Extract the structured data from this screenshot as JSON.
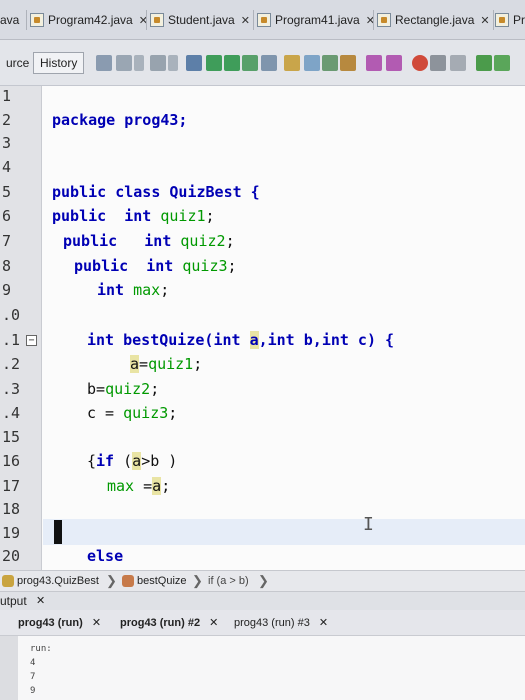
{
  "tabs": [
    {
      "label": "ava"
    },
    {
      "label": "Program42.java"
    },
    {
      "label": "Student.java"
    },
    {
      "label": "Program41.java"
    },
    {
      "label": "Rectangle.java"
    },
    {
      "label": "Pro"
    }
  ],
  "close_glyph": "✕",
  "toolbar": {
    "source_label": "urce",
    "history_label": "History"
  },
  "line_numbers": [
    "1",
    "2",
    "3",
    "4",
    "5",
    "6",
    "7",
    "8",
    "9",
    ".0",
    ".1",
    ".2",
    ".3",
    ".4",
    "15",
    "16",
    "17",
    "18",
    "19",
    "20"
  ],
  "code": {
    "l2_kw": "package",
    "l2_rest": " prog43;",
    "l5_kw1": "public",
    "l5_kw2": "class",
    "l5_rest": " QuizBest {",
    "l6_kw1": "public",
    "l6_kw2": "int",
    "l6_field": "quiz1",
    "l6_end": ";",
    "l7_kw1": "public",
    "l7_kw2": "int",
    "l7_field": "quiz2",
    "l7_end": ";",
    "l8_kw1": "public",
    "l8_kw2": "int",
    "l8_field": "quiz3",
    "l8_end": ";",
    "l9_kw": "int",
    "l9_field": "max",
    "l9_end": ";",
    "l11_kw": "int",
    "l11_name": " bestQuize(",
    "l11_int1": "int",
    "l11_a": "a",
    "l11_c1": ",",
    "l11_int2": "int",
    "l11_b": " b,",
    "l11_int3": "int",
    "l11_c": " c) {",
    "l12_a": "a",
    "l12_eq": "=",
    "l12_field": "quiz1",
    "l12_end": ";",
    "l13_b": "b=",
    "l13_field": "quiz2",
    "l13_end": ";",
    "l14_c": "c = ",
    "l14_field": "quiz3",
    "l14_end": ";",
    "l16_open": "{",
    "l16_kw": "if",
    "l16_p": " (",
    "l16_a": "a",
    "l16_gt": ">b )",
    "l17_field": "max",
    "l17_eq": " =",
    "l17_a": "a",
    "l17_end": ";",
    "l20_kw": "else"
  },
  "fold_glyph": "−",
  "ibeam_glyph": "I",
  "breadcrumb": {
    "item1": "prog43.QuizBest",
    "item2": "bestQuize",
    "item3": "if (a > b)",
    "chevron": "❯"
  },
  "output_panel": {
    "title": "utput",
    "close": "✕",
    "tabs": [
      {
        "label": "prog43 (run)"
      },
      {
        "label": "prog43 (run) #2"
      },
      {
        "label": "prog43 (run) #3"
      }
    ],
    "lines": [
      "run:",
      "4",
      "7",
      "9"
    ]
  },
  "colors": {
    "keyword": "#0000b4",
    "field": "#009900",
    "highlight": "#e9e4a4"
  }
}
